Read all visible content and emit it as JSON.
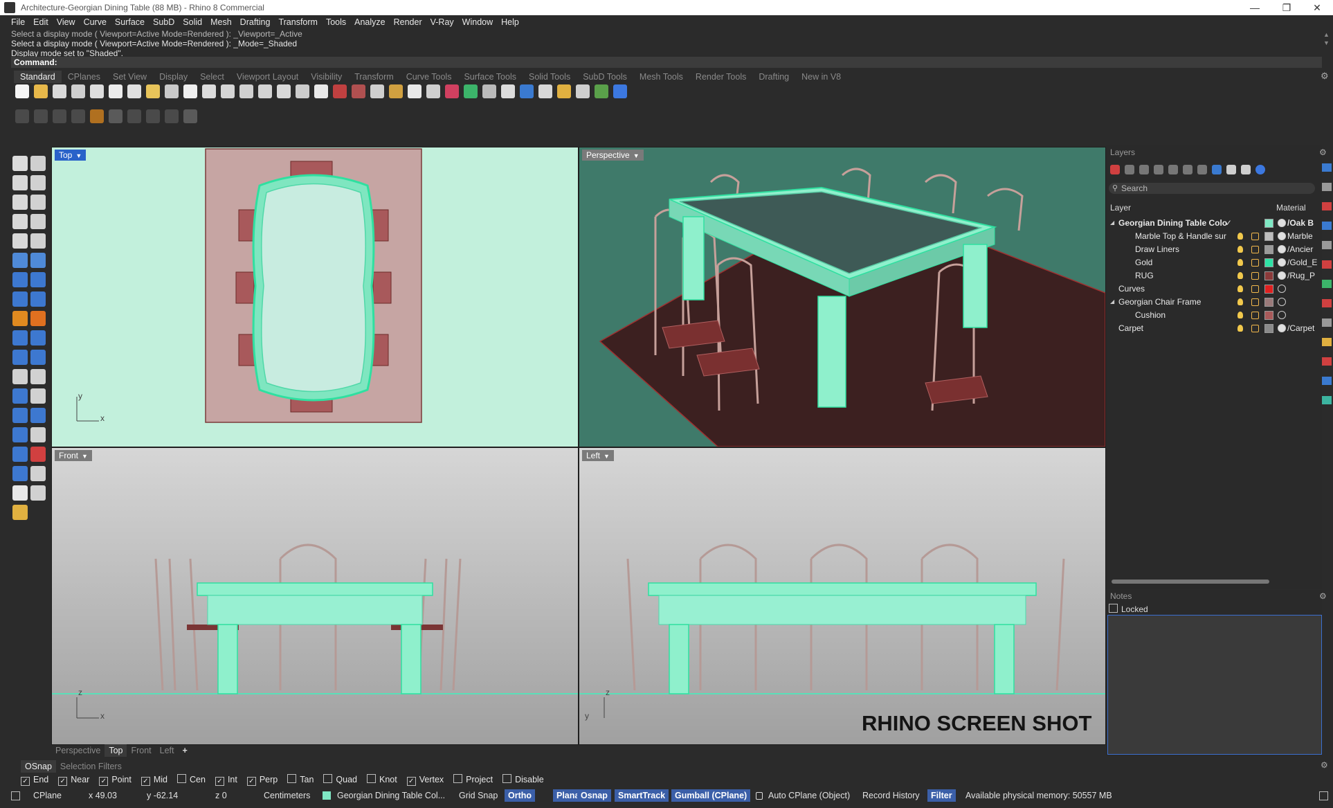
{
  "window": {
    "title": "Architecture-Georgian Dining Table (88 MB) - Rhino 8 Commercial",
    "controls": [
      "—",
      "❐",
      "✕"
    ]
  },
  "menu": [
    "File",
    "Edit",
    "View",
    "Curve",
    "Surface",
    "SubD",
    "Solid",
    "Mesh",
    "Drafting",
    "Transform",
    "Tools",
    "Analyze",
    "Render",
    "V-Ray",
    "Window",
    "Help"
  ],
  "command": {
    "history": [
      "Select a display mode ( Viewport=Active  Mode=Rendered ): _Viewport=_Active",
      "Select a display mode ( Viewport=Active  Mode=Rendered ): _Mode=_Shaded",
      "Display mode set to \"Shaded\"."
    ],
    "prompt": "Command:"
  },
  "toolbar_tabs": [
    "Standard",
    "CPlanes",
    "Set View",
    "Display",
    "Select",
    "Viewport Layout",
    "Visibility",
    "Transform",
    "Curve Tools",
    "Surface Tools",
    "Solid Tools",
    "SubD Tools",
    "Mesh Tools",
    "Render Tools",
    "Drafting",
    "New in V8"
  ],
  "viewports": {
    "top": {
      "label": "Top",
      "axis_y": "y",
      "axis_x": "x"
    },
    "perspective": {
      "label": "Perspective"
    },
    "front": {
      "label": "Front",
      "axis_z": "z",
      "axis_x": "x"
    },
    "left": {
      "label": "Left",
      "axis_z": "z",
      "axis_y": "y"
    }
  },
  "watermark": "RHINO SCREEN SHOT",
  "layers_panel": {
    "title": "Layers",
    "search_placeholder": "Search",
    "col_layer": "Layer",
    "col_material": "Material",
    "rows": [
      {
        "name": "Georgian Dining Table Colo",
        "material": "/Oak B",
        "color": "#7fe8c4",
        "bold": true,
        "toggle": "◢",
        "indent": 0
      },
      {
        "name": "Marble Top & Handle sur",
        "material": "Marble",
        "color": "#bdbdbd",
        "indent": 2
      },
      {
        "name": "Draw Liners",
        "material": "/Ancier",
        "color": "#9a9a9a",
        "indent": 2
      },
      {
        "name": "Gold",
        "material": "/Gold_E",
        "color": "#2fe2a6",
        "indent": 2
      },
      {
        "name": "RUG",
        "material": "/Rug_P",
        "color": "#8b3a3a",
        "indent": 2
      },
      {
        "name": "Curves",
        "material": "",
        "color": "#e02020",
        "indent": 0
      },
      {
        "name": "Georgian Chair Frame",
        "material": "",
        "color": "#9a7a7a",
        "toggle": "◢",
        "indent": 0
      },
      {
        "name": "Cushion",
        "material": "",
        "color": "#a85a5a",
        "indent": 2
      },
      {
        "name": "Carpet",
        "material": "/Carpet",
        "color": "#8a8a8a",
        "indent": 0
      }
    ]
  },
  "notes_panel": {
    "title": "Notes",
    "locked_label": "Locked"
  },
  "viewport_tabs": [
    "Perspective",
    "Top",
    "Front",
    "Left",
    "+"
  ],
  "osnap": {
    "tabs": [
      "OSnap",
      "Selection Filters"
    ],
    "items": [
      {
        "label": "End",
        "checked": true
      },
      {
        "label": "Near",
        "checked": true
      },
      {
        "label": "Point",
        "checked": true
      },
      {
        "label": "Mid",
        "checked": true
      },
      {
        "label": "Cen",
        "checked": false
      },
      {
        "label": "Int",
        "checked": true
      },
      {
        "label": "Perp",
        "checked": true
      },
      {
        "label": "Tan",
        "checked": false
      },
      {
        "label": "Quad",
        "checked": false
      },
      {
        "label": "Knot",
        "checked": false
      },
      {
        "label": "Vertex",
        "checked": true
      },
      {
        "label": "Project",
        "checked": false
      },
      {
        "label": "Disable",
        "checked": false
      }
    ]
  },
  "status": {
    "cplane": "CPlane",
    "x": "x 49.03",
    "y": "y -62.14",
    "z": "z 0",
    "units": "Centimeters",
    "layer": "Georgian Dining Table Col...",
    "grid_snap": "Grid Snap",
    "ortho": "Ortho",
    "planar": "Planar",
    "osnap": "Osnap",
    "smarttrack": "SmartTrack",
    "gumball": "Gumball (CPlane)",
    "auto_cplane": "Auto CPlane (Object)",
    "record_history": "Record History",
    "filter": "Filter",
    "memory": "Available physical memory: 50557 MB"
  },
  "colors": {
    "accent_blue": "#2962c9",
    "top_bg": "#c2f0dc",
    "persp_bg": "#3f7a6a",
    "ortho_bg_top": "#d4d4d4",
    "ortho_bg_bottom": "#9e9e9e",
    "table_mint": "#8ff0cc",
    "chair_pink": "#c6a09a",
    "rug": "#4a2626"
  }
}
